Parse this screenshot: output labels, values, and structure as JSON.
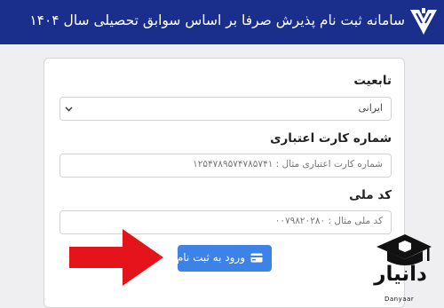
{
  "header": {
    "title": "سامانه ثبت نام پذیرش صرفا بر اساس سوابق تحصیلی سال ۱۴۰۴",
    "logo_icon": "university-logo-icon",
    "background": "#1a2f8c"
  },
  "form": {
    "nationality": {
      "label": "تابعیت",
      "selected": "ایرانی",
      "icon": "chevron-down-icon"
    },
    "card_number": {
      "label": "شماره کارت اعتباری",
      "placeholder": "شماره کارت اعتباری مثال : ۱۲۵۴۷۸۹۵۷۴۷۸۵۷۴۱"
    },
    "national_code": {
      "label": "کد ملی",
      "placeholder": "کد ملی مثال : ۰۰۷۹۸۲۰۲۸۰"
    },
    "submit": {
      "label": "ورود به ثبت نام",
      "icon": "credit-card-icon",
      "color": "#3d82e6"
    }
  },
  "annotation": {
    "arrow_icon": "red-arrow-icon",
    "color": "#e5141b"
  },
  "watermark": {
    "text": "دانیار",
    "subtext": "Danyaar",
    "icon": "graduation-cap-icon"
  }
}
